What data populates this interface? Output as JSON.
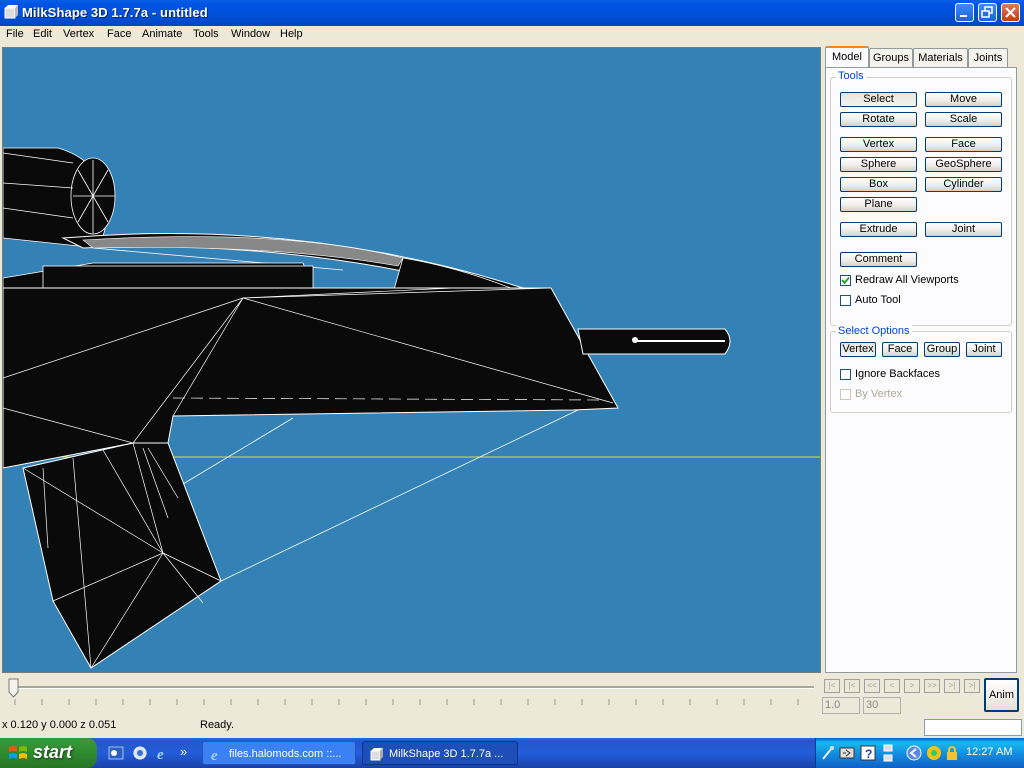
{
  "window": {
    "title": "MilkShape 3D 1.7.7a - untitled"
  },
  "menu": [
    "File",
    "Edit",
    "Vertex",
    "Face",
    "Animate",
    "Tools",
    "Window",
    "Help"
  ],
  "tabs": [
    "Model",
    "Groups",
    "Materials",
    "Joints"
  ],
  "tools": {
    "group_label": "Tools",
    "buttons": [
      "Select",
      "Move",
      "Rotate",
      "Scale",
      "Vertex",
      "Face",
      "Sphere",
      "GeoSphere",
      "Box",
      "Cylinder",
      "Plane",
      "Extrude",
      "Joint",
      "Comment"
    ],
    "redraw_all": "Redraw All Viewports",
    "auto_tool": "Auto Tool"
  },
  "select_options": {
    "group_label": "Select Options",
    "buttons": [
      "Vertex",
      "Face",
      "Group",
      "Joint"
    ],
    "ignore_backfaces": "Ignore Backfaces",
    "by_vertex": "By Vertex"
  },
  "timeline": {
    "start_frame": "1.0",
    "end_frame": "30",
    "anim_label": "Anim"
  },
  "status": {
    "coords": "x 0.120 y 0.000 z 0.051",
    "message": "Ready."
  },
  "taskbar": {
    "start": "start",
    "tasks": [
      "files.halomods.com ::...",
      "MilkShape 3D 1.7.7a ..."
    ],
    "clock": "12:27 AM"
  },
  "colors": {
    "viewport_bg": "#3381b5",
    "axis_line": "#c8e832",
    "titlebar": "#0054e3"
  }
}
